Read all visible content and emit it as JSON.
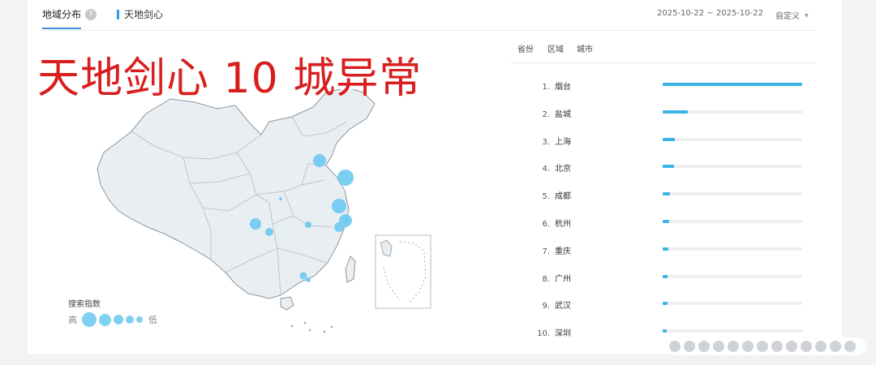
{
  "header": {
    "tab_region": "地域分布",
    "help_icon": "?",
    "tab_keyword": "天地剑心",
    "date_range": "2025-10-22 ~ 2025-10-22",
    "custom_label": "自定义",
    "custom_caret": "▼"
  },
  "headline": "天地剑心 10 城异常",
  "legend": {
    "title": "搜索指数",
    "high": "高",
    "low": "低"
  },
  "region_tabs": [
    "省份",
    "区域",
    "城市"
  ],
  "ranking": [
    {
      "rank": "1.",
      "city": "烟台",
      "share": 1.0
    },
    {
      "rank": "2.",
      "city": "盐城",
      "share": 0.18
    },
    {
      "rank": "3.",
      "city": "上海",
      "share": 0.09
    },
    {
      "rank": "4.",
      "city": "北京",
      "share": 0.08
    },
    {
      "rank": "5.",
      "city": "成都",
      "share": 0.055
    },
    {
      "rank": "6.",
      "city": "杭州",
      "share": 0.045
    },
    {
      "rank": "7.",
      "city": "重庆",
      "share": 0.04
    },
    {
      "rank": "8.",
      "city": "广州",
      "share": 0.035
    },
    {
      "rank": "9.",
      "city": "武汉",
      "share": 0.035
    },
    {
      "rank": "10.",
      "city": "深圳",
      "share": 0.03
    }
  ],
  "colors": {
    "accent": "#3ab3e6",
    "headline": "#d91e1e",
    "map_fill": "#e9eef3",
    "bubble": "#6ccaf0"
  }
}
